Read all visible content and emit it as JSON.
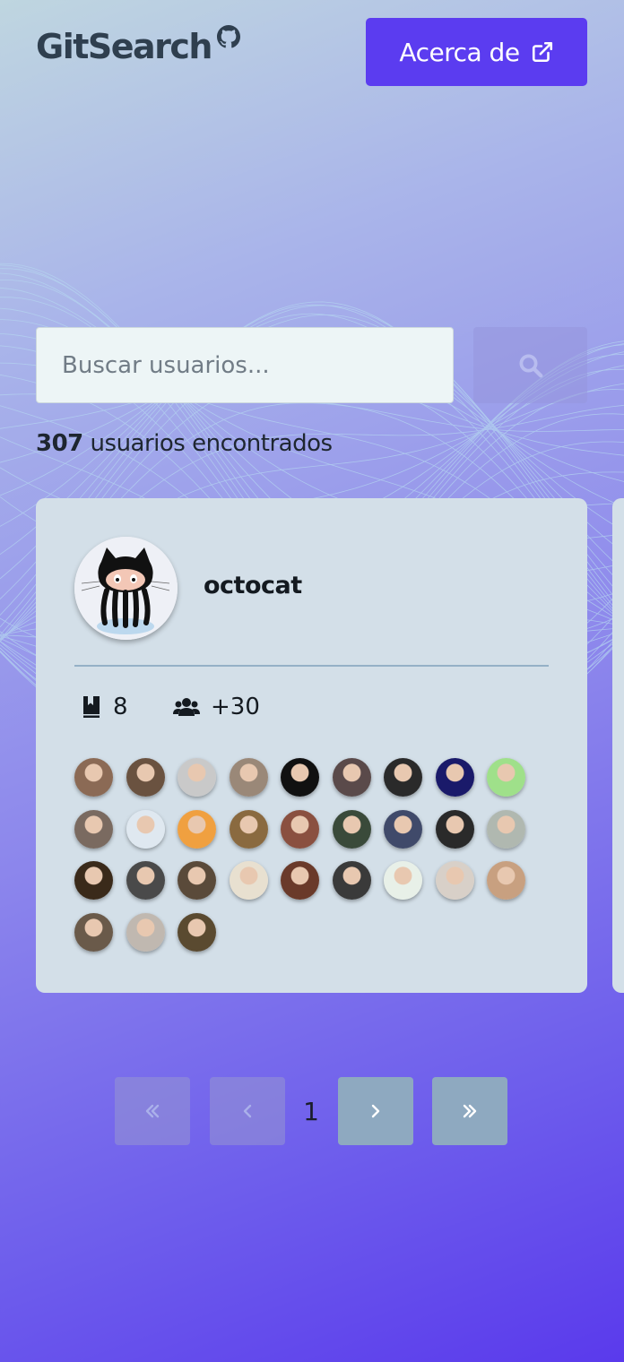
{
  "header": {
    "logo_text": "GitSearch",
    "logo_icon": "github-mark-icon",
    "about_label": "Acerca de",
    "about_icon": "external-link-icon"
  },
  "search": {
    "placeholder": "Buscar usuarios...",
    "value": "",
    "button_icon": "search-icon"
  },
  "results": {
    "count": "307",
    "label": "usuarios encontrados"
  },
  "user_card": {
    "username": "octocat",
    "avatar_icon": "octocat-avatar",
    "repos_icon": "book-icon",
    "repos": "8",
    "followers_icon": "users-icon",
    "followers": "+30",
    "follower_avatar_count": 30
  },
  "pagination": {
    "first_icon": "double-chevron-left-icon",
    "prev_icon": "chevron-left-icon",
    "current": "1",
    "next_icon": "chevron-right-icon",
    "last_icon": "double-chevron-right-icon"
  },
  "colors": {
    "accent": "#5b3cf0",
    "card_bg": "#d3dfe8",
    "pager_enabled": "#8ea9c0"
  }
}
